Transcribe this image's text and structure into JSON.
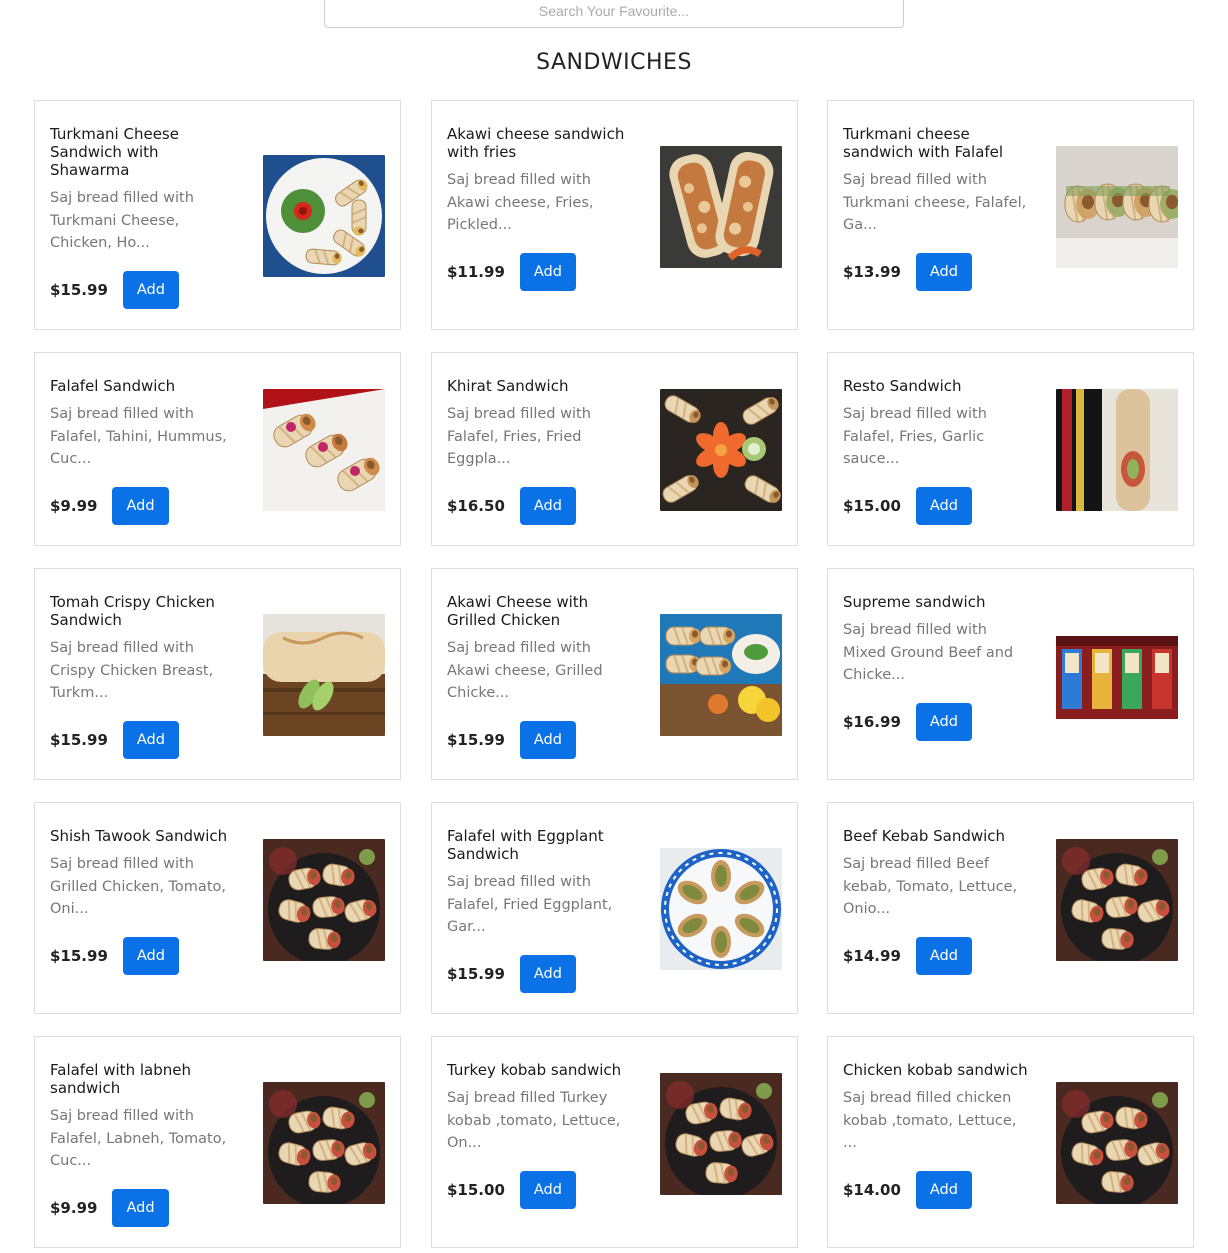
{
  "search": {
    "placeholder": "Search Your Favourite..."
  },
  "section": {
    "title": "SANDWICHES"
  },
  "add_label": "Add",
  "items": [
    {
      "name": "Turkmani Cheese Sandwich with Shawarma",
      "desc": "Saj bread filled with Turkmani Cheese, Chicken, Ho...",
      "price": "$15.99",
      "image": "plate-wraps-tomato-rose"
    },
    {
      "name": "Akawi cheese sandwich with fries",
      "desc": "Saj bread filled with Akawi cheese, Fries, Pickled...",
      "price": "$11.99",
      "image": "wrap-halves-dark"
    },
    {
      "name": "Turkmani cheese sandwich with Falafel",
      "desc": "Saj bread filled with Turkmani cheese, Falafel, Ga...",
      "price": "$13.99",
      "image": "wrap-rolls-light"
    },
    {
      "name": "Falafel Sandwich",
      "desc": "Saj bread filled with Falafel, Tahini, Hummus, Cuc...",
      "price": "$9.99",
      "image": "falafel-wraps-red"
    },
    {
      "name": "Khirat Sandwich",
      "desc": "Saj bread filled with Falafel, Fries, Fried Eggpla...",
      "price": "$16.50",
      "image": "platter-carrot-flower"
    },
    {
      "name": "Resto Sandwich",
      "desc": "Saj bread filled with Falafel, Fries, Garlic sauce...",
      "price": "$15.00",
      "image": "long-wrap-dark"
    },
    {
      "name": "Tomah Crispy Chicken Sandwich",
      "desc": "Saj bread filled with Crispy Chicken Breast, Turkm...",
      "price": "$15.99",
      "image": "wrap-wood-board"
    },
    {
      "name": "Akawi Cheese with Grilled Chicken",
      "desc": "Saj bread filled with Akawi cheese, Grilled Chicke...",
      "price": "$15.99",
      "image": "platter-lemon-blue"
    },
    {
      "name": "Supreme sandwich",
      "desc": "Saj bread filled with Mixed Ground Beef and Chicke...",
      "price": "$16.99",
      "image": "restaurant-interior"
    },
    {
      "name": "Shish Tawook Sandwich",
      "desc": "Saj bread filled with Grilled Chicken, Tomato, Oni...",
      "price": "$15.99",
      "image": "wrap-pieces-dark-plate"
    },
    {
      "name": "Falafel with Eggplant Sandwich",
      "desc": "Saj bread filled with Falafel, Fried Eggplant, Gar...",
      "price": "$15.99",
      "image": "blue-plate-wraps"
    },
    {
      "name": "Beef Kebab Sandwich",
      "desc": "Saj bread filled Beef kebab, Tomato, Lettuce, Onio...",
      "price": "$14.99",
      "image": "wrap-pieces-dark-plate"
    },
    {
      "name": "Falafel with labneh sandwich",
      "desc": "Saj bread filled with Falafel, Labneh, Tomato, Cuc...",
      "price": "$9.99",
      "image": "wrap-pieces-dark-plate"
    },
    {
      "name": "Turkey kobab sandwich",
      "desc": "Saj bread filled Turkey kobab ,tomato, Lettuce, On...",
      "price": "$15.00",
      "image": "wrap-pieces-dark-plate"
    },
    {
      "name": "Chicken kobab sandwich",
      "desc": "Saj bread filled chicken kobab ,tomato, Lettuce, ...",
      "price": "$14.00",
      "image": "wrap-pieces-dark-plate"
    }
  ]
}
